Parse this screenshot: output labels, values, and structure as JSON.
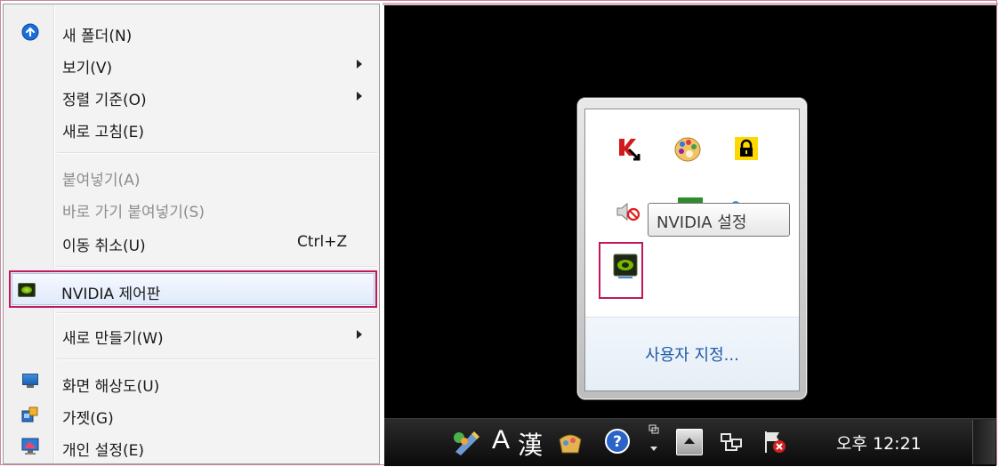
{
  "context_menu": {
    "items": [
      {
        "label": "새 폴더(N)",
        "icon": "new-folder-icon"
      },
      {
        "label": "보기(V)",
        "submenu": true
      },
      {
        "label": "정렬 기준(O)",
        "submenu": true
      },
      {
        "label": "새로 고침(E)"
      },
      {
        "label": "붙여넣기(A)",
        "disabled": true
      },
      {
        "label": "바로 가기 붙여넣기(S)",
        "disabled": true
      },
      {
        "label": "이동 취소(U)",
        "shortcut": "Ctrl+Z"
      },
      {
        "label": "NVIDIA 제어판",
        "icon": "nvidia-icon",
        "highlighted": true
      },
      {
        "label": "새로 만들기(W)",
        "submenu": true
      },
      {
        "label": "화면 해상도(U)",
        "icon": "screen-resolution-icon"
      },
      {
        "label": "가젯(G)",
        "icon": "gadgets-icon"
      },
      {
        "label": "개인 설정(E)",
        "icon": "personalize-icon"
      }
    ]
  },
  "tray_popup": {
    "icons": [
      "kaspersky-icon",
      "paint-palette-icon",
      "lock-icon",
      "volume-muted-icon",
      "green-app-icon",
      "blue-app-icon",
      "nvidia-icon"
    ],
    "tooltip": "NVIDIA 설정",
    "customize_link": "사용자 지정..."
  },
  "taskbar": {
    "ime_letter": "A",
    "hanja": "漢",
    "clock": "오후 12:21"
  },
  "colors": {
    "highlight_border": "#c2185b",
    "nvidia_green": "#76b900",
    "link_blue": "#1e5aa8"
  }
}
